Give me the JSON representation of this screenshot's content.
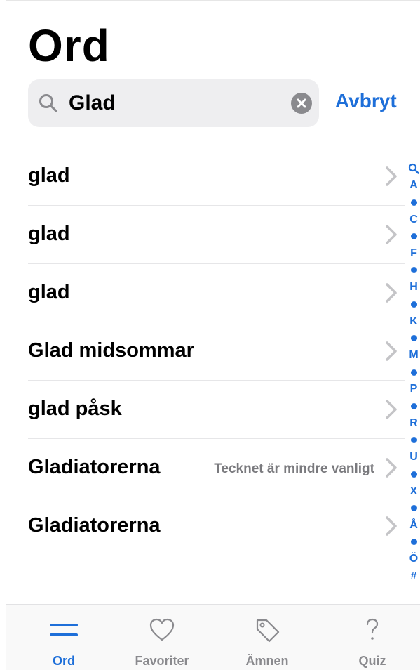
{
  "header": {
    "title": "Ord"
  },
  "search": {
    "value": "Glad",
    "cancel_label": "Avbryt"
  },
  "results": [
    {
      "label": "glad",
      "note": ""
    },
    {
      "label": "glad",
      "note": ""
    },
    {
      "label": "glad",
      "note": ""
    },
    {
      "label": "Glad midsommar",
      "note": ""
    },
    {
      "label": "glad påsk",
      "note": ""
    },
    {
      "label": "Gladiatorerna",
      "note": "Tecknet är mindre vanligt"
    },
    {
      "label": "Gladiatorerna",
      "note": ""
    }
  ],
  "index": [
    "Q",
    "A",
    "•",
    "C",
    "•",
    "F",
    "•",
    "H",
    "•",
    "K",
    "•",
    "M",
    "•",
    "P",
    "•",
    "R",
    "•",
    "U",
    "•",
    "X",
    "•",
    "Å",
    "•",
    "Ö",
    "#"
  ],
  "tabs": [
    {
      "label": "Ord",
      "icon": "list-lines-icon",
      "active": true
    },
    {
      "label": "Favoriter",
      "icon": "heart-icon",
      "active": false
    },
    {
      "label": "Ämnen",
      "icon": "tag-icon",
      "active": false
    },
    {
      "label": "Quiz",
      "icon": "question-mark-icon",
      "active": false
    }
  ],
  "colors": {
    "accent": "#1e6fd9",
    "secondary_text": "#7a7a7e"
  }
}
